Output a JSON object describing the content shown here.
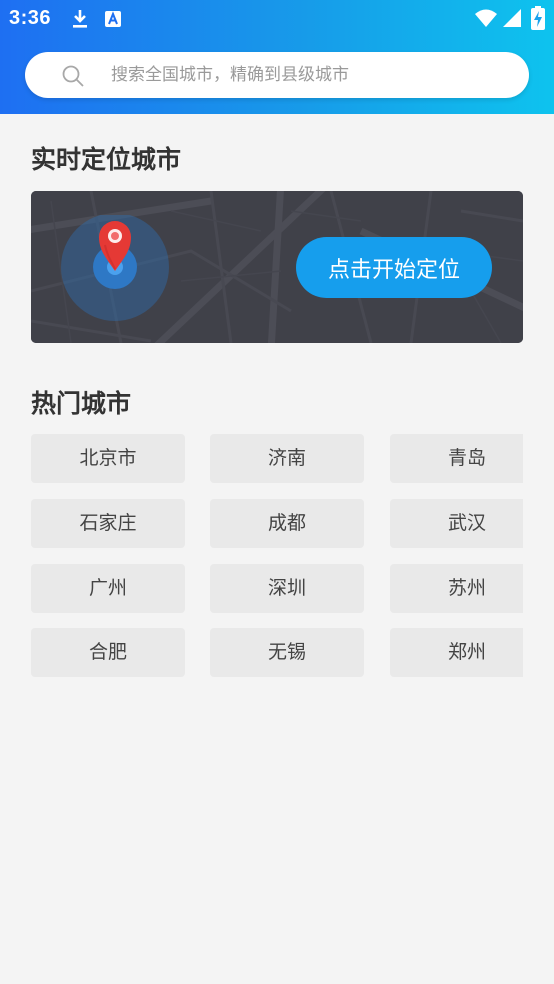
{
  "status_bar": {
    "time": "3:36",
    "icons": [
      "download-icon",
      "text-a-icon",
      "wifi-icon",
      "signal-icon",
      "battery-charging-icon"
    ]
  },
  "search": {
    "placeholder": "搜索全国城市，精确到县级城市",
    "value": "",
    "icon": "search-icon"
  },
  "location": {
    "title": "实时定位城市",
    "button_label": "点击开始定位",
    "icon": "map-pin-icon"
  },
  "hot": {
    "title": "热门城市",
    "cities": [
      "北京市",
      "济南",
      "青岛",
      "石家庄",
      "成都",
      "武汉",
      "广州",
      "深圳",
      "苏州",
      "合肥",
      "无锡",
      "郑州"
    ]
  },
  "colors": {
    "header_start": "#1e6ff2",
    "header_end": "#0ec3ee",
    "accent": "#169eed",
    "map_bg": "#404149"
  }
}
